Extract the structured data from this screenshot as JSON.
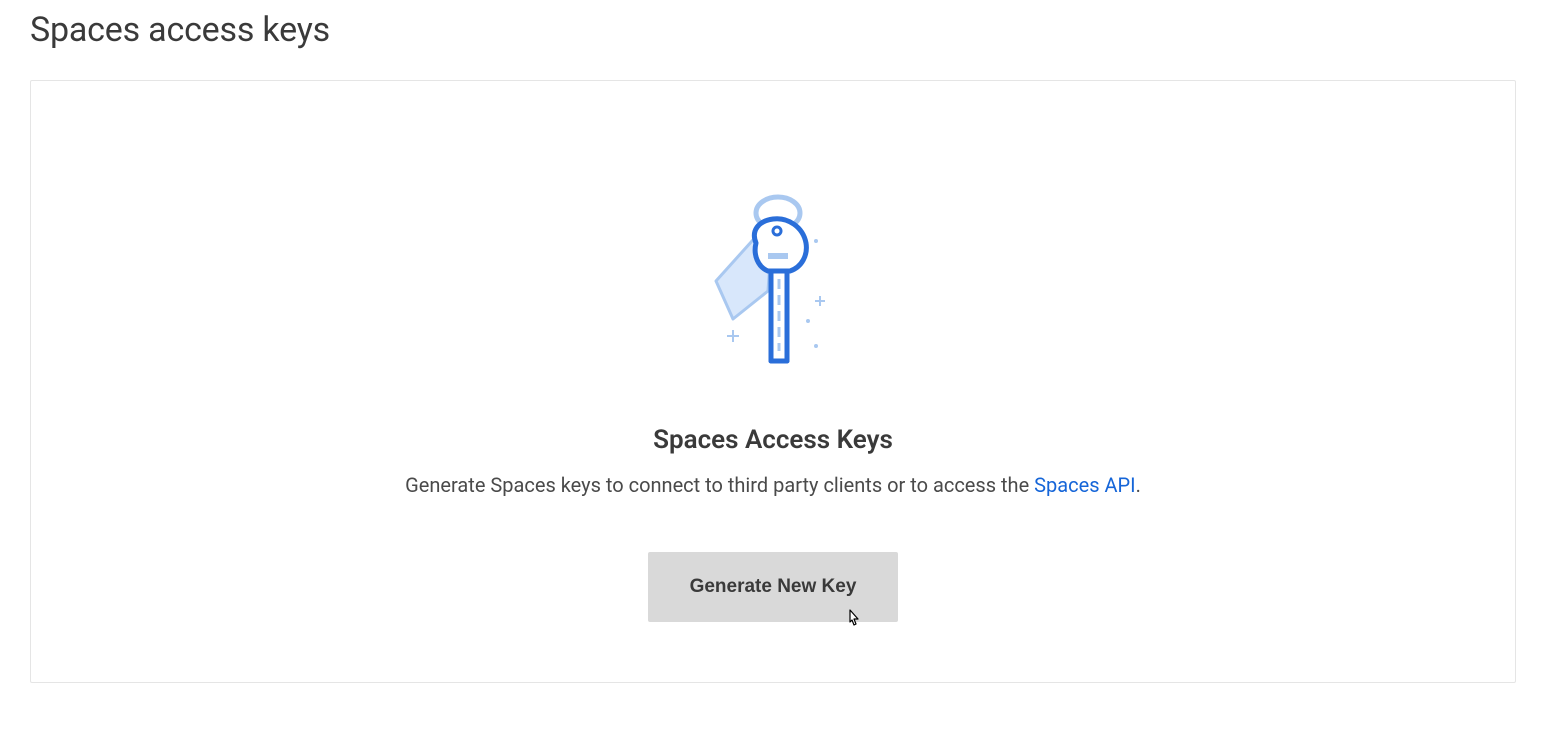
{
  "page": {
    "title": "Spaces access keys"
  },
  "panel": {
    "heading": "Spaces Access Keys",
    "description_prefix": "Generate Spaces keys to connect to third party clients or to access the ",
    "description_link_text": "Spaces API",
    "description_suffix": ".",
    "button_label": "Generate New Key"
  }
}
